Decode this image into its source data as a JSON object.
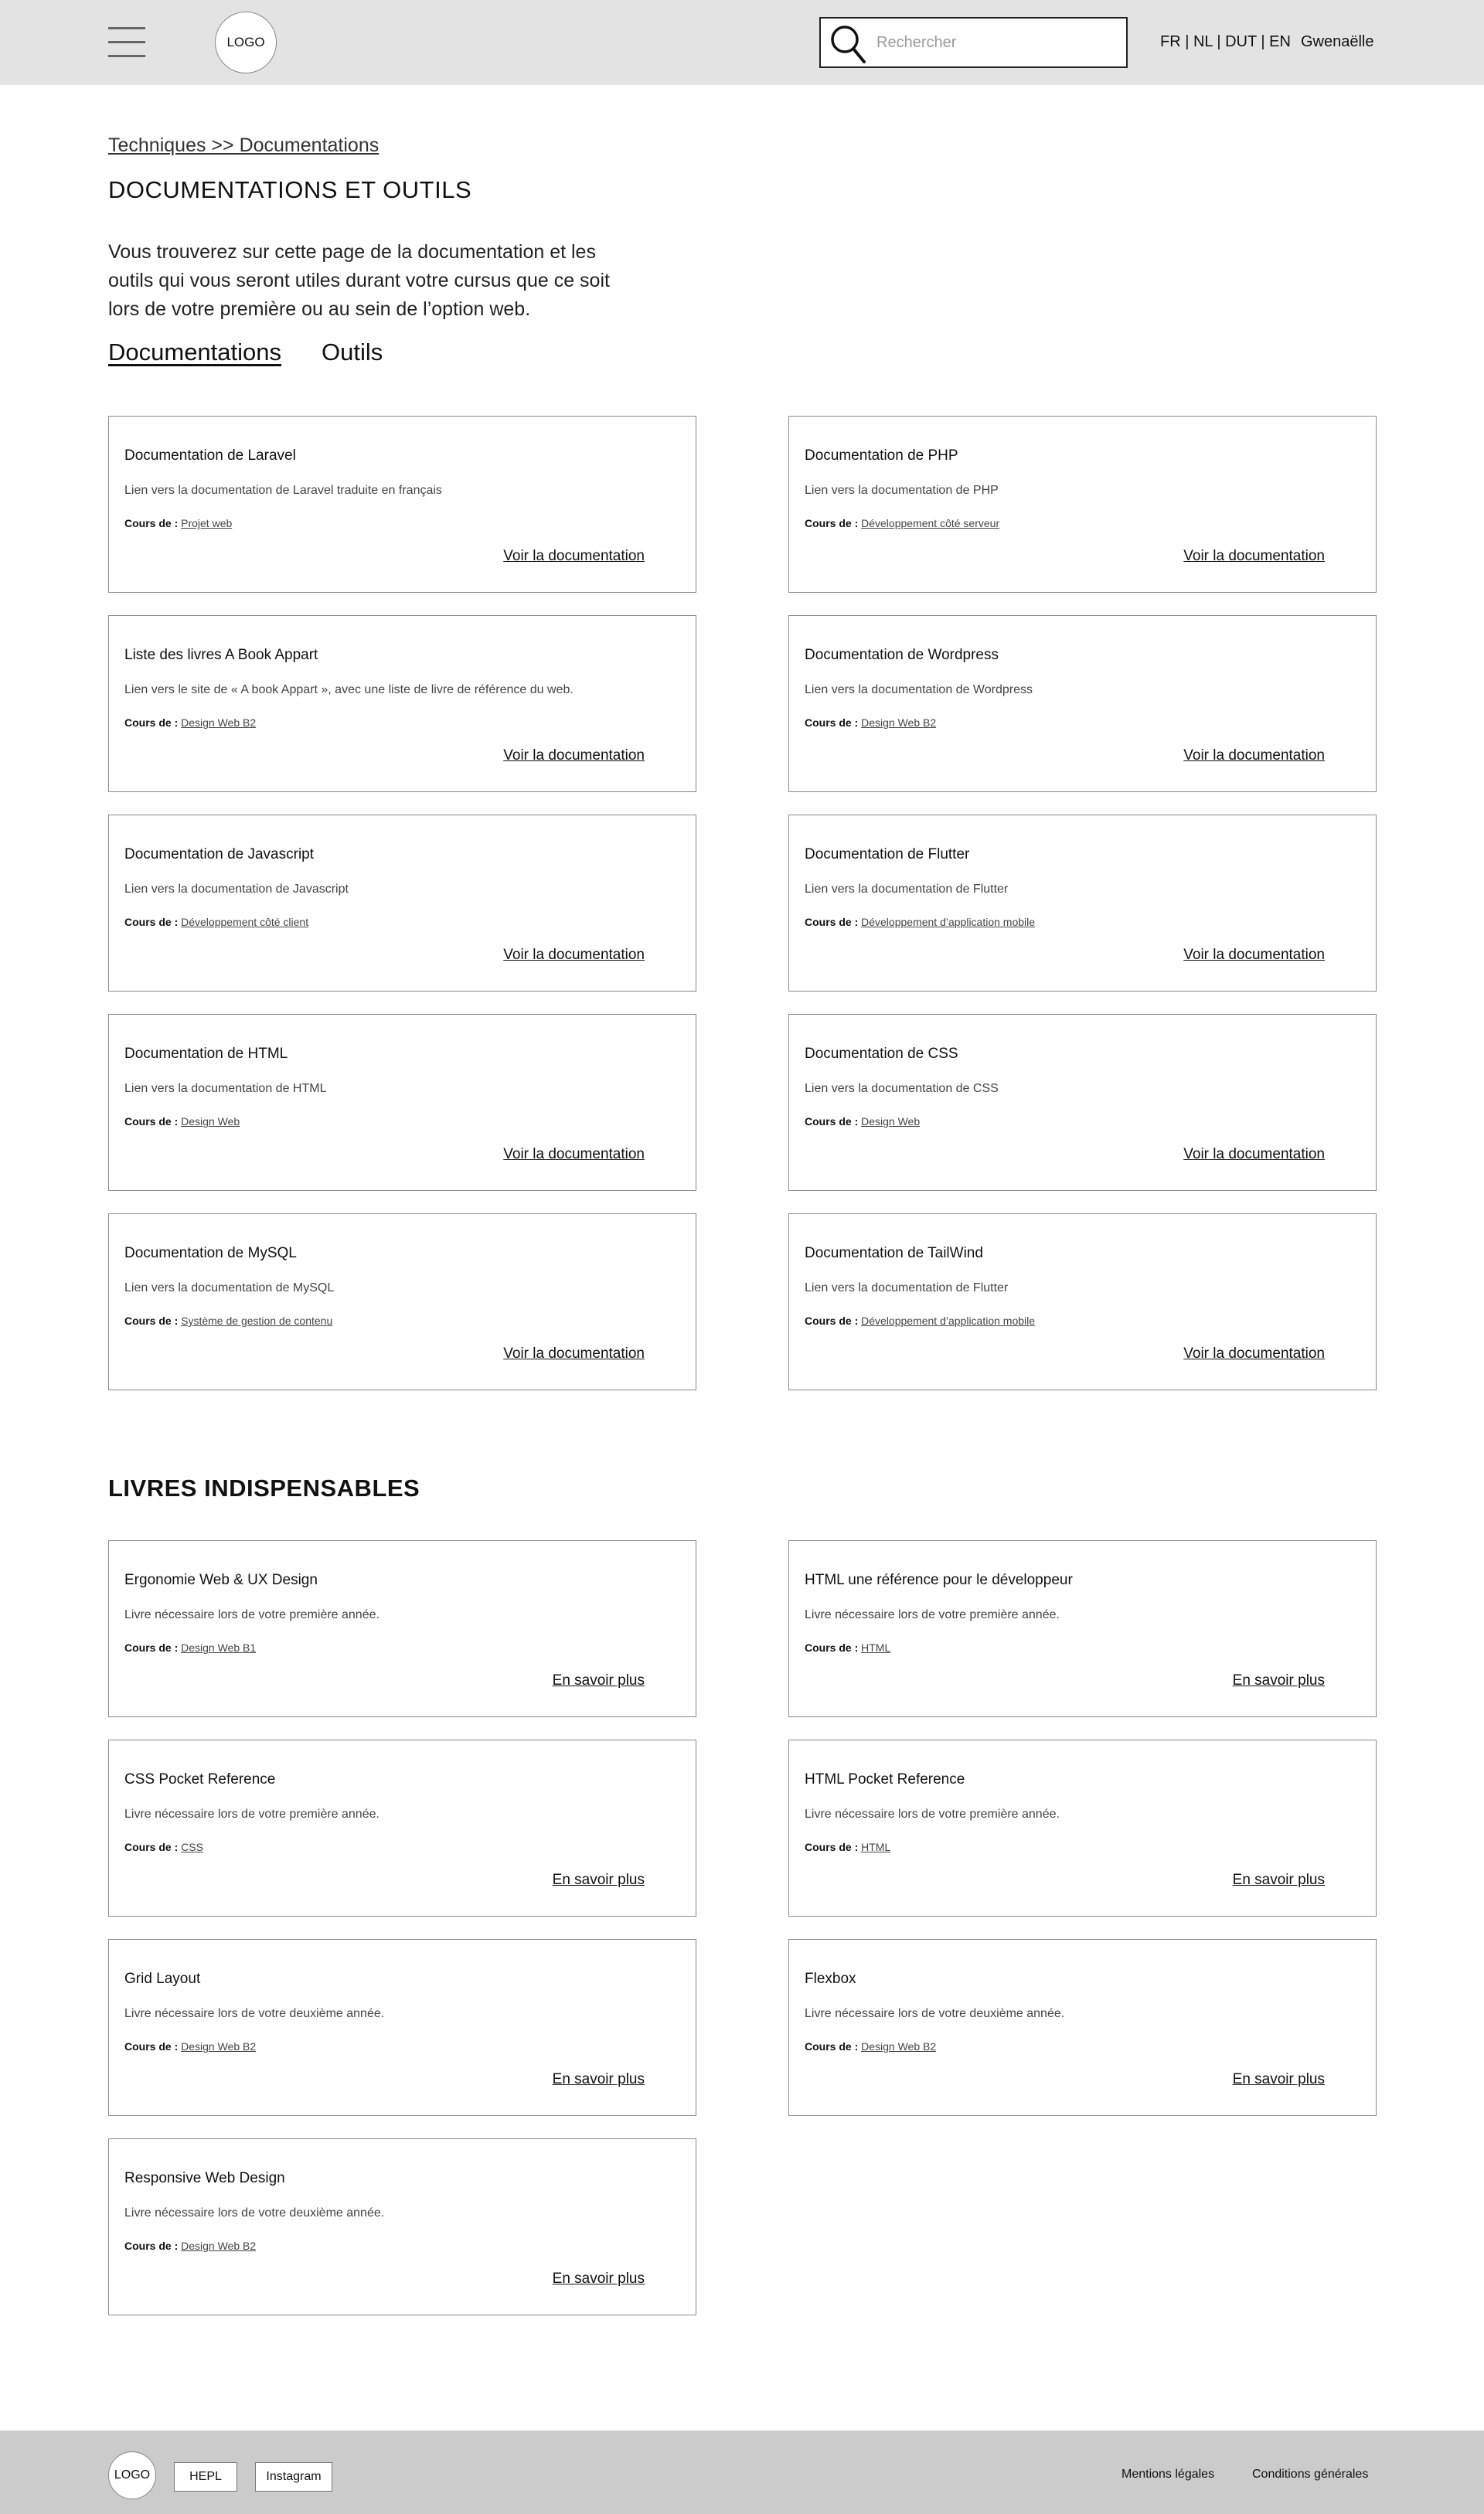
{
  "header": {
    "logo_text": "LOGO",
    "search_placeholder": "Rechercher",
    "languages": "FR | NL | DUT | EN",
    "user_name": "Gwenaëlle"
  },
  "main": {
    "breadcrumb": "Techniques >> Documentations",
    "title": "DOCUMENTATIONS ET OUTILS",
    "intro": "Vous trouverez sur cette page de la documentation et les outils qui vous seront utiles durant votre cursus que ce soit lors de votre première ou au sein de l’option web.",
    "tabs": [
      {
        "label": "Documentations",
        "active": true
      },
      {
        "label": "Outils",
        "active": false
      }
    ],
    "course_prefix": "Cours de :",
    "docs": [
      {
        "title": "Documentation de Laravel",
        "desc": "Lien vers la documentation de Laravel traduite en français",
        "course": "Projet web",
        "link": "Voir la documentation"
      },
      {
        "title": "Documentation de PHP",
        "desc": "Lien vers la documentation de PHP",
        "course": "Développement côté serveur",
        "link": "Voir la documentation"
      },
      {
        "title": "Liste des livres A Book Appart",
        "desc": "Lien vers le site de « A book Appart », avec une liste de livre de référence du web.",
        "course": "Design Web B2",
        "link": "Voir la documentation"
      },
      {
        "title": "Documentation de Wordpress",
        "desc": "Lien vers la documentation de Wordpress",
        "course": "Design Web B2",
        "link": "Voir la documentation"
      },
      {
        "title": "Documentation de Javascript",
        "desc": "Lien vers la documentation de Javascript",
        "course": "Développement côté client",
        "link": "Voir la documentation"
      },
      {
        "title": "Documentation de Flutter",
        "desc": "Lien vers la documentation de Flutter",
        "course": "Développement d’application mobile",
        "link": "Voir la documentation"
      },
      {
        "title": "Documentation de HTML",
        "desc": "Lien vers la documentation de HTML",
        "course": "Design Web",
        "link": "Voir la documentation"
      },
      {
        "title": "Documentation de CSS",
        "desc": "Lien vers la documentation de CSS",
        "course": "Design Web ",
        "link": "Voir la documentation"
      },
      {
        "title": "Documentation de MySQL",
        "desc": "Lien vers la documentation de MySQL",
        "course": "Système de gestion de contenu",
        "link": "Voir la documentation"
      },
      {
        "title": "Documentation de TailWind",
        "desc": "Lien vers la documentation de Flutter",
        "course": "Développement d’application mobile",
        "link": "Voir la documentation"
      }
    ],
    "books_title": "LIVRES INDISPENSABLES",
    "books": [
      {
        "title": "Ergonomie Web & UX Design",
        "desc": "Livre nécessaire lors de votre première année.",
        "course": "Design Web B1",
        "link": "En savoir plus"
      },
      {
        "title": "HTML une référence pour le développeur",
        "desc": "Livre nécessaire lors de votre première année.",
        "course": "HTML",
        "link": "En savoir plus"
      },
      {
        "title": "CSS Pocket Reference",
        "desc": "Livre nécessaire lors de votre première année.",
        "course": "CSS",
        "link": "En savoir plus"
      },
      {
        "title": "HTML Pocket Reference",
        "desc": "Livre nécessaire lors de votre première année.",
        "course": "HTML",
        "link": "En savoir plus"
      },
      {
        "title": "Grid Layout",
        "desc": "Livre nécessaire lors de votre deuxième année.",
        "course": "Design Web B2",
        "link": "En savoir plus"
      },
      {
        "title": "Flexbox",
        "desc": "Livre nécessaire lors de votre deuxième année.",
        "course": "Design Web B2",
        "link": "En savoir plus"
      },
      {
        "title": "Responsive Web Design",
        "desc": "Livre nécessaire lors de votre deuxième année.",
        "course": "Design Web B2",
        "link": "En savoir plus"
      }
    ]
  },
  "footer": {
    "logo_text": "LOGO",
    "hepl": "HEPL",
    "instagram": "Instagram",
    "mentions": "Mentions légales",
    "conditions": "Conditions générales"
  }
}
